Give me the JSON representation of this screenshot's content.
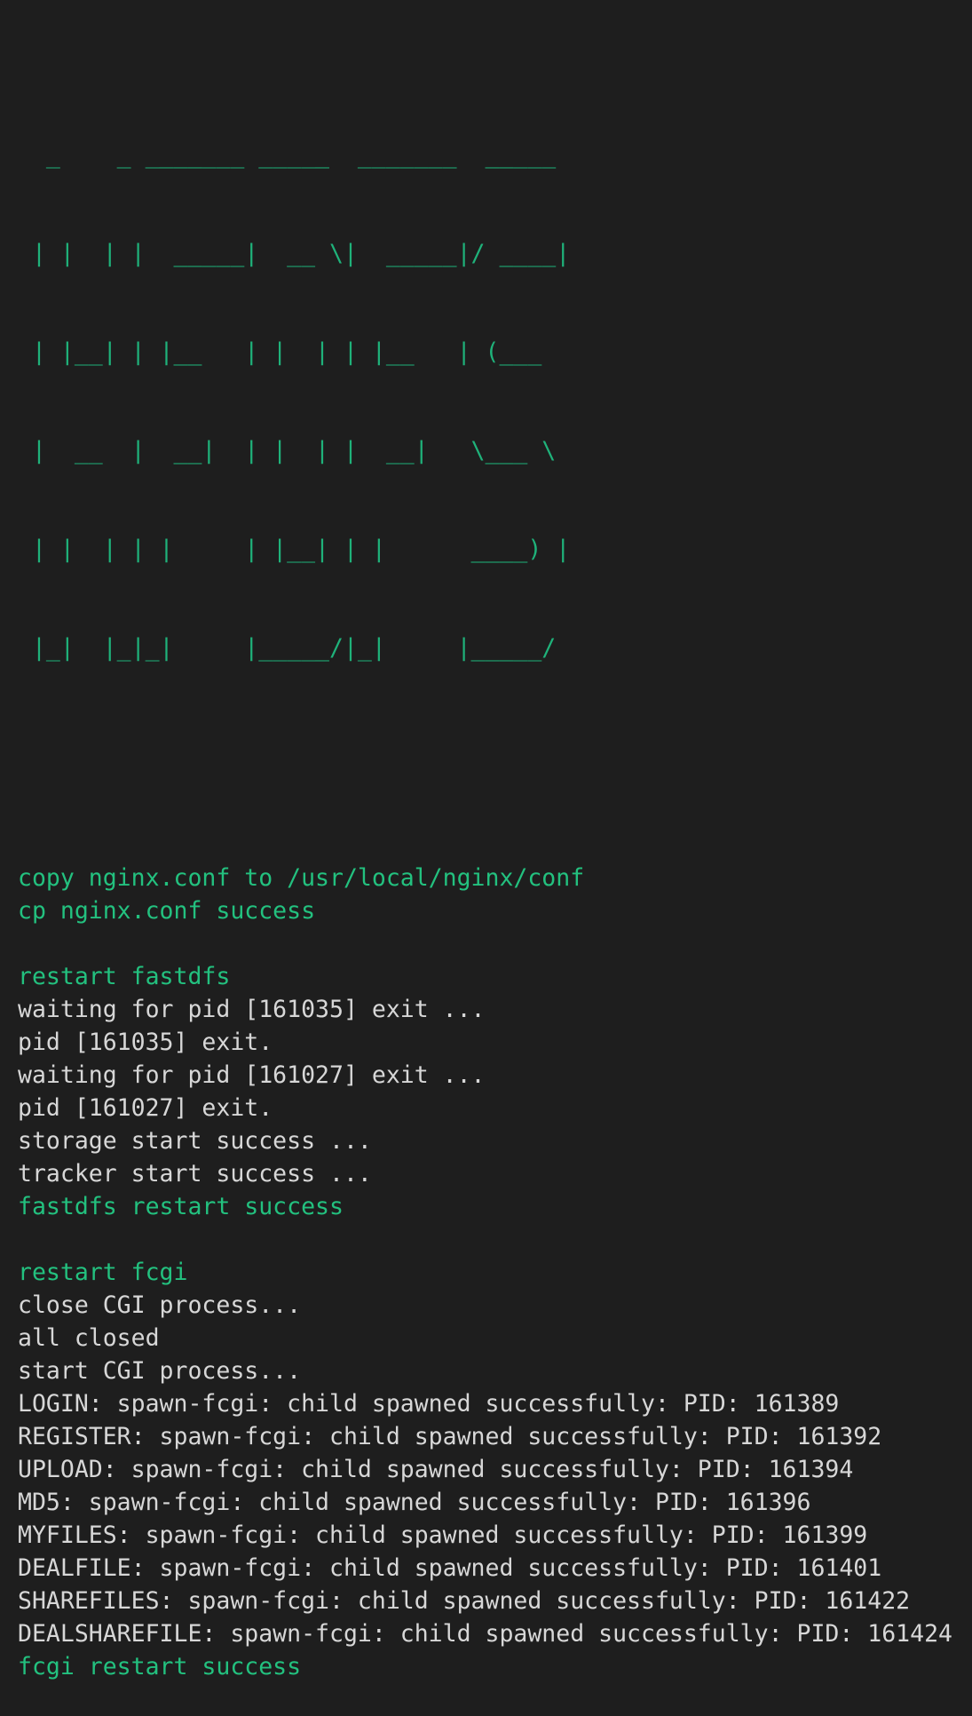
{
  "banner": [
    "  _    _ _______ _____  _______  _____ ",
    " | |  | |  _____|  __ \\|  _____|/ ____|",
    " | |__| | |__   | |  | | |__   | (___  ",
    " |  __  |  __|  | |  | |  __|   \\___ \\ ",
    " | |  | | |     | |__| | |      ____) |",
    " |_|  |_|_|     |_____/|_|     |_____/ "
  ],
  "sections": [
    {
      "lines": [
        {
          "text": "copy nginx.conf to /usr/local/nginx/conf",
          "style": "green"
        },
        {
          "text": "cp nginx.conf success",
          "style": "green"
        }
      ]
    },
    {
      "lines": [
        {
          "text": "restart fastdfs",
          "style": "green"
        },
        {
          "text": "waiting for pid [161035] exit ...",
          "style": "white"
        },
        {
          "text": "pid [161035] exit.",
          "style": "white"
        },
        {
          "text": "waiting for pid [161027] exit ...",
          "style": "white"
        },
        {
          "text": "pid [161027] exit.",
          "style": "white"
        },
        {
          "text": "storage start success ...",
          "style": "white"
        },
        {
          "text": "tracker start success ...",
          "style": "white"
        },
        {
          "text": "fastdfs restart success",
          "style": "green"
        }
      ]
    },
    {
      "lines": [
        {
          "text": "restart fcgi",
          "style": "green"
        },
        {
          "text": "close CGI process...",
          "style": "white"
        },
        {
          "text": "all closed",
          "style": "white"
        },
        {
          "text": "start CGI process...",
          "style": "white"
        },
        {
          "text": "LOGIN: spawn-fcgi: child spawned successfully: PID: 161389",
          "style": "white"
        },
        {
          "text": "REGISTER: spawn-fcgi: child spawned successfully: PID: 161392",
          "style": "white"
        },
        {
          "text": "UPLOAD: spawn-fcgi: child spawned successfully: PID: 161394",
          "style": "white"
        },
        {
          "text": "MD5: spawn-fcgi: child spawned successfully: PID: 161396",
          "style": "white"
        },
        {
          "text": "MYFILES: spawn-fcgi: child spawned successfully: PID: 161399",
          "style": "white"
        },
        {
          "text": "DEALFILE: spawn-fcgi: child spawned successfully: PID: 161401",
          "style": "white"
        },
        {
          "text": "SHAREFILES: spawn-fcgi: child spawned successfully: PID: 161422",
          "style": "white"
        },
        {
          "text": "DEALSHAREFILE: spawn-fcgi: child spawned successfully: PID: 161424",
          "style": "white"
        },
        {
          "text": "fcgi restart success",
          "style": "green"
        }
      ]
    }
  ]
}
